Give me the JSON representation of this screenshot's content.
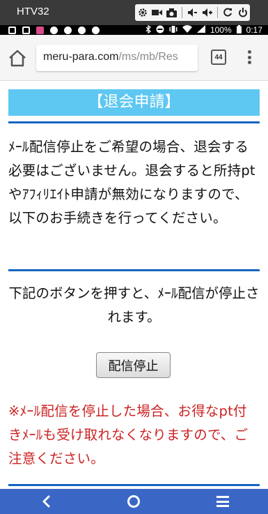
{
  "emulator": {
    "title": "HTV32",
    "tools": [
      "settings-icon",
      "video-icon",
      "camera-icon",
      "volume-down-icon",
      "volume-up-icon",
      "rotate-icon",
      "power-icon"
    ]
  },
  "status_bar": {
    "battery": "100%",
    "time": "0:17"
  },
  "browser": {
    "url_domain": "meru-para.com",
    "url_path": "/ms/mb/Res",
    "tab_count": "44"
  },
  "page": {
    "title": "【退会申請】",
    "intro": "ﾒｰﾙ配信停止をご希望の場合、退会する必要はございません。退会すると所持ptやｱﾌｨﾘｴｲﾄ申請が無効になりますので、以下のお手続きを行ってください。",
    "instruction": "下記のボタンを押すと、ﾒｰﾙ配信が停止されます。",
    "stop_button": "配信停止",
    "warning": "※ﾒｰﾙ配信を停止した場合、お得なpt付きﾒｰﾙも受け取れなくなりますので、ご注意ください。"
  },
  "colors": {
    "title_bg": "#5ec7f2",
    "rule": "#1565c0",
    "warning": "#cc2222",
    "nav_bar": "#3a67c5"
  }
}
